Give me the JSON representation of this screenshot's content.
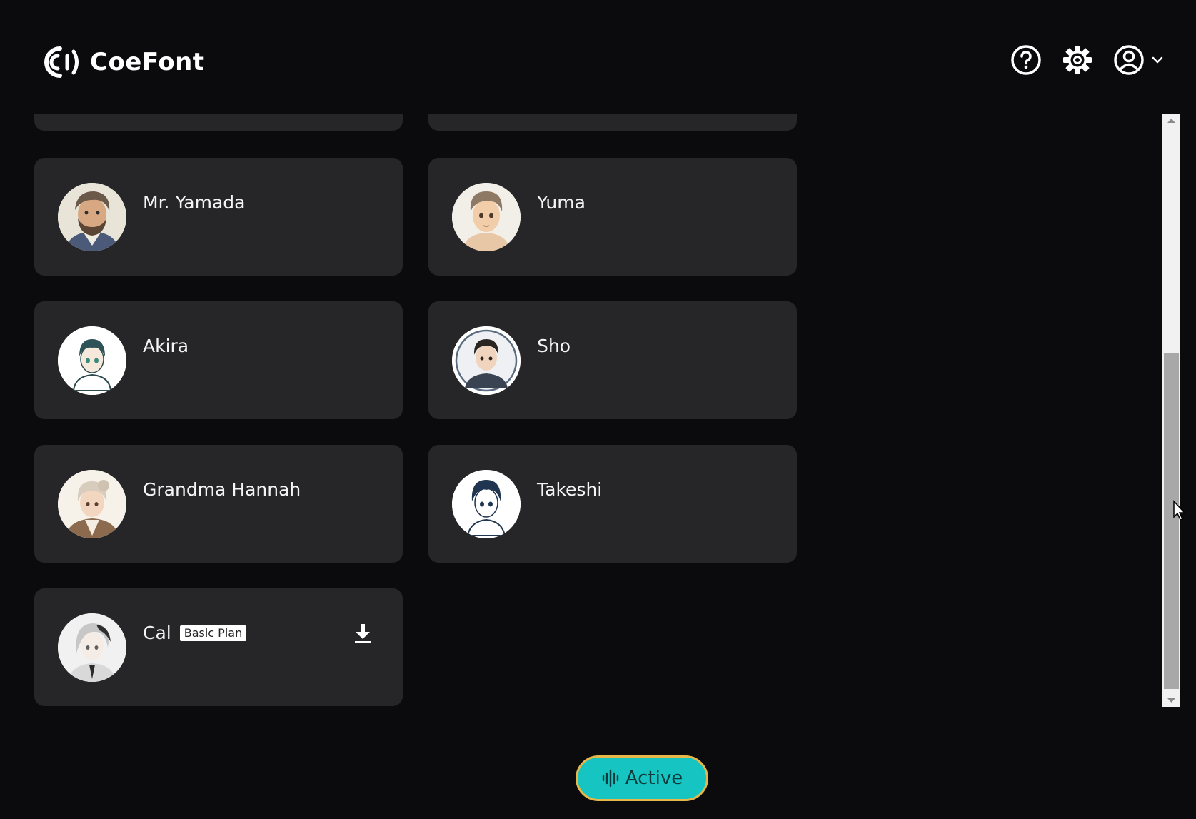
{
  "header": {
    "logo_text": "CoeFont",
    "icons": [
      "help-icon",
      "settings-icon",
      "account-icon",
      "chevron-down-icon"
    ]
  },
  "voices": [
    {
      "name": "Mr. Yamada"
    },
    {
      "name": "Yuma"
    },
    {
      "name": "Akira"
    },
    {
      "name": "Sho"
    },
    {
      "name": "Grandma Hannah"
    },
    {
      "name": "Takeshi"
    },
    {
      "name": "Cal",
      "badge": "Basic Plan",
      "downloadable": true
    }
  ],
  "footer": {
    "active_label": "Active"
  },
  "colors": {
    "background": "#0b0b0d",
    "card": "#262629",
    "accent_teal": "#16c4c2",
    "accent_gold": "#e6b84a"
  }
}
